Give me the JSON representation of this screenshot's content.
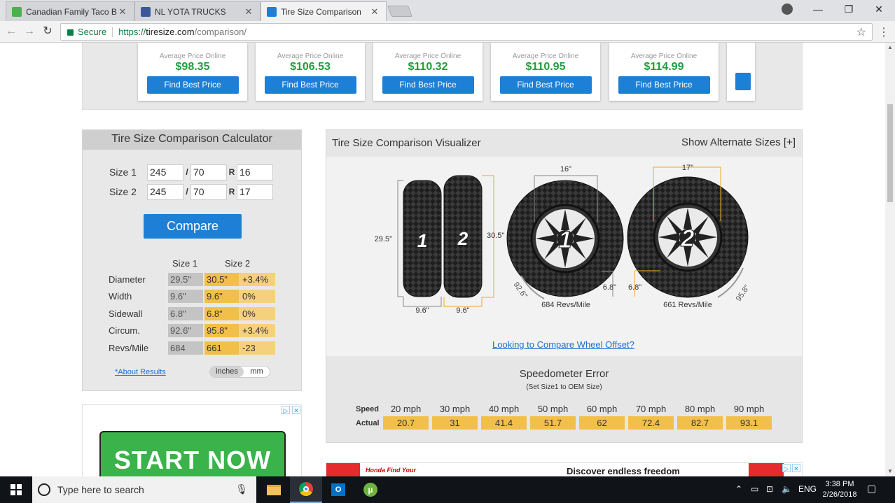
{
  "browser": {
    "tabs": [
      {
        "title": "Canadian Family Taco Bu",
        "favicon_color": "#4caf50",
        "active": false
      },
      {
        "title": "NL YOTA TRUCKS",
        "favicon_color": "#3b5998",
        "active": false
      },
      {
        "title": "Tire Size Comparison",
        "favicon_color": "#1e7fd6",
        "active": true
      }
    ],
    "secure_label": "Secure",
    "url_scheme": "https://",
    "url_host": "tiresize.com",
    "url_path": "/comparison/"
  },
  "price_cards": {
    "label": "Average Price Online",
    "button_label": "Find Best Price",
    "prices": [
      "$98.35",
      "$106.53",
      "$110.32",
      "$110.95",
      "$114.99"
    ]
  },
  "calculator": {
    "title": "Tire Size Comparison Calculator",
    "size1": {
      "label": "Size 1",
      "width": "245",
      "aspect": "70",
      "rim": "16"
    },
    "size2": {
      "label": "Size 2",
      "width": "245",
      "aspect": "70",
      "rim": "17"
    },
    "slash": "/",
    "r_label": "R",
    "compare_label": "Compare",
    "col_size1": "Size 1",
    "col_size2": "Size 2",
    "results": [
      {
        "label": "Diameter",
        "s1": "29.5\"",
        "s2": "30.5\"",
        "diff": "+3.4%"
      },
      {
        "label": "Width",
        "s1": "9.6\"",
        "s2": "9.6\"",
        "diff": "0%"
      },
      {
        "label": "Sidewall",
        "s1": "6.8\"",
        "s2": "6.8\"",
        "diff": "0%"
      },
      {
        "label": "Circum.",
        "s1": "92.6\"",
        "s2": "95.8\"",
        "diff": "+3.4%"
      },
      {
        "label": "Revs/Mile",
        "s1": "684",
        "s2": "661",
        "diff": "-23"
      }
    ],
    "about_link": "*About Results",
    "unit_inches": "inches",
    "unit_mm": "mm"
  },
  "visualizer": {
    "title": "Tire Size Comparison Visualizer",
    "alt_sizes": "Show Alternate Sizes [+]",
    "tire1": {
      "number": "1",
      "height": "29.5\"",
      "width": "9.6\"",
      "rim": "16\"",
      "sidewall": "6.8\"",
      "circumference": "92.6\"",
      "revs": "684 Revs/Mile"
    },
    "tire2": {
      "number": "2",
      "height": "30.5\"",
      "width": "9.6\"",
      "rim": "17\"",
      "sidewall": "6.8\"",
      "circumference": "95.8\"",
      "revs": "661 Revs/Mile"
    },
    "offset_link": "Looking to Compare Wheel Offset?"
  },
  "speedometer": {
    "title": "Speedometer Error",
    "subtitle": "(Set Size1 to OEM Size)",
    "speed_label": "Speed",
    "actual_label": "Actual",
    "speeds": [
      "20 mph",
      "30 mph",
      "40 mph",
      "50 mph",
      "60 mph",
      "70 mph",
      "80 mph",
      "90 mph"
    ],
    "actuals": [
      "20.7",
      "31",
      "41.4",
      "51.7",
      "62",
      "72.4",
      "82.7",
      "93.1"
    ]
  },
  "ads": {
    "start_now": "START NOW",
    "honda": "Honda Find Your",
    "discover": "Discover endless freedom"
  },
  "taskbar": {
    "search_placeholder": "Type here to search",
    "language": "ENG",
    "time": "3:38 PM",
    "date": "2/26/2018"
  }
}
